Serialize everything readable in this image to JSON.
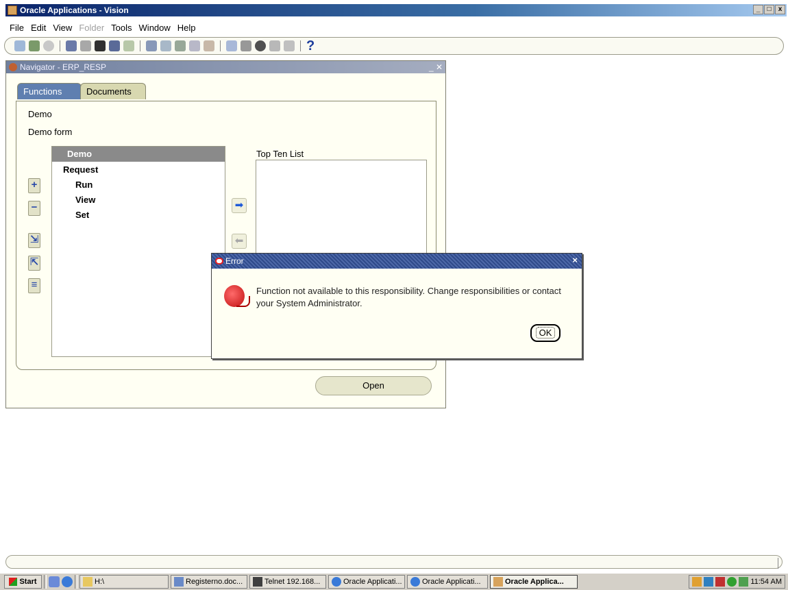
{
  "app": {
    "title": "Oracle Applications - Vision",
    "controls": [
      "_",
      "□",
      "x"
    ]
  },
  "menu": [
    {
      "label": "File",
      "disabled": false
    },
    {
      "label": "Edit",
      "disabled": false
    },
    {
      "label": "View",
      "disabled": false
    },
    {
      "label": "Folder",
      "disabled": true
    },
    {
      "label": "Tools",
      "disabled": false
    },
    {
      "label": "Window",
      "disabled": false
    },
    {
      "label": "Help",
      "disabled": false
    }
  ],
  "toolbar": {
    "help_glyph": "?"
  },
  "navigator": {
    "title": "Navigator - ERP_RESP",
    "window_controls": "_ ✕",
    "tabs": {
      "functions": "Functions",
      "documents": "Documents"
    },
    "crumbs": [
      "Demo",
      "Demo form"
    ],
    "tree": {
      "selected": "Demo",
      "items": [
        "Request",
        "Run",
        "View",
        "Set"
      ]
    },
    "side_buttons": [
      "+",
      "−",
      "⇲",
      "⇱",
      "≡"
    ],
    "top_ten_label": "Top Ten List",
    "open_label": "Open"
  },
  "error_dialog": {
    "title": "Error",
    "close": "×",
    "message": "Function not available to this responsibility.  Change responsibilities or contact your System Administrator.",
    "ok_label": "OK"
  },
  "taskbar": {
    "start_label": "Start",
    "items": [
      {
        "label": "H:\\",
        "active": false
      },
      {
        "label": "Registerno.doc...",
        "active": false
      },
      {
        "label": "Telnet 192.168...",
        "active": false
      },
      {
        "label": "Oracle Applicati...",
        "active": false
      },
      {
        "label": "Oracle Applicati...",
        "active": false
      },
      {
        "label": "Oracle Applica...",
        "active": true
      }
    ],
    "clock": "11:54 AM"
  }
}
